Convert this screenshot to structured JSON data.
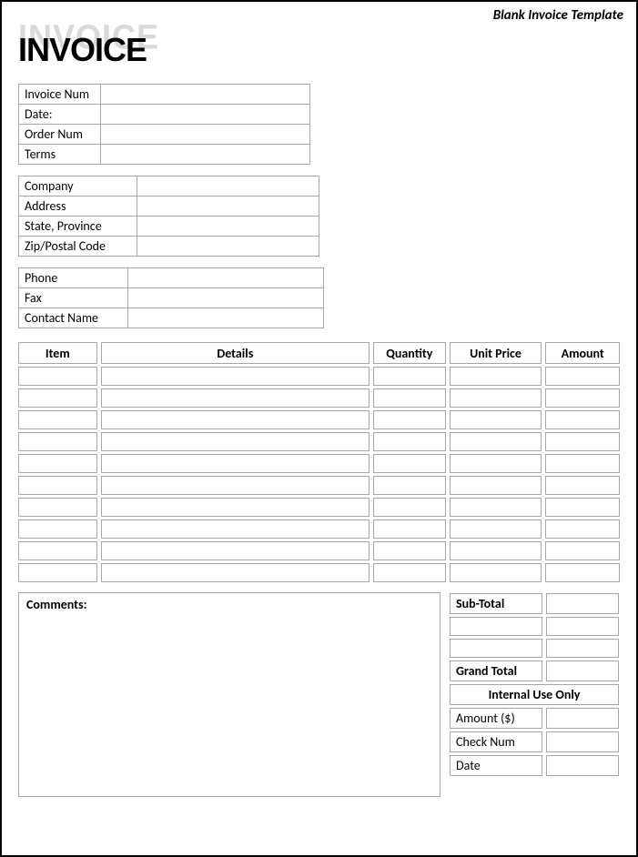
{
  "top_label": "Blank Invoice Template",
  "logo_text": "INVOICE",
  "block1": {
    "invoice_num_label": "Invoice Num",
    "invoice_num": "",
    "date_label": "Date:",
    "date": "",
    "order_num_label": "Order Num",
    "order_num": "",
    "terms_label": "Terms",
    "terms": ""
  },
  "block2": {
    "company_label": "Company",
    "company": "",
    "address_label": "Address",
    "address": "",
    "state_label": "State, Province",
    "state": "",
    "zip_label": "Zip/Postal Code",
    "zip": ""
  },
  "block3": {
    "phone_label": "Phone",
    "phone": "",
    "fax_label": "Fax",
    "fax": "",
    "contact_label": "Contact Name",
    "contact": ""
  },
  "items": {
    "headers": {
      "item": "Item",
      "details": "Details",
      "quantity": "Quantity",
      "unit_price": "Unit Price",
      "amount": "Amount"
    },
    "rows": [
      {
        "item": "",
        "details": "",
        "quantity": "",
        "unit_price": "",
        "amount": ""
      },
      {
        "item": "",
        "details": "",
        "quantity": "",
        "unit_price": "",
        "amount": ""
      },
      {
        "item": "",
        "details": "",
        "quantity": "",
        "unit_price": "",
        "amount": ""
      },
      {
        "item": "",
        "details": "",
        "quantity": "",
        "unit_price": "",
        "amount": ""
      },
      {
        "item": "",
        "details": "",
        "quantity": "",
        "unit_price": "",
        "amount": ""
      },
      {
        "item": "",
        "details": "",
        "quantity": "",
        "unit_price": "",
        "amount": ""
      },
      {
        "item": "",
        "details": "",
        "quantity": "",
        "unit_price": "",
        "amount": ""
      },
      {
        "item": "",
        "details": "",
        "quantity": "",
        "unit_price": "",
        "amount": ""
      },
      {
        "item": "",
        "details": "",
        "quantity": "",
        "unit_price": "",
        "amount": ""
      },
      {
        "item": "",
        "details": "",
        "quantity": "",
        "unit_price": "",
        "amount": ""
      }
    ]
  },
  "comments_label": "Comments:",
  "totals": {
    "subtotal_label": "Sub-Total",
    "subtotal": "",
    "blank1_label": "",
    "blank1_val": "",
    "blank2_label": "",
    "blank2_val": "",
    "grand_total_label": "Grand Total",
    "grand_total": "",
    "internal_header": "Internal Use Only",
    "amount_label": "Amount ($)",
    "amount": "",
    "check_label": "Check Num",
    "check": "",
    "date_label": "Date",
    "date": ""
  }
}
